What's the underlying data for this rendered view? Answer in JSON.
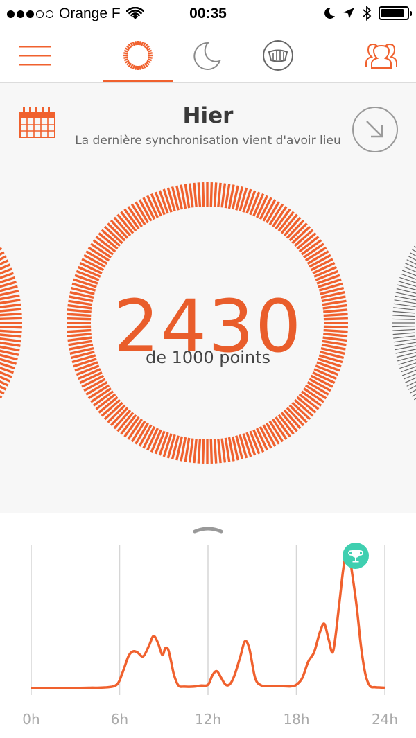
{
  "status_bar": {
    "carrier": "Orange F",
    "time": "00:35",
    "signal_strength": 3,
    "signal_max": 5,
    "battery_level": 0.9,
    "icons": [
      "wifi-icon",
      "moon-icon",
      "location-arrow-icon",
      "bluetooth-icon",
      "battery-icon"
    ]
  },
  "nav": {
    "items": [
      "menu-icon",
      "activity-ring-icon",
      "sleep-moon-icon",
      "meal-plate-icon",
      "friends-icon"
    ],
    "active": "activity-ring-icon"
  },
  "header": {
    "title": "Hier",
    "subtitle": "La dernière synchronisation vient d'avoir lieu"
  },
  "score": {
    "value": "2430",
    "goal_text": "de 1000 points"
  },
  "colors": {
    "accent": "#f0612e",
    "trophy": "#3fcfb0",
    "ring_neighbor": "#666666"
  },
  "chart_data": {
    "type": "line",
    "x_tick_labels": [
      "0h",
      "6h",
      "12h",
      "18h",
      "24h"
    ],
    "xlim": [
      0,
      24
    ],
    "grid": true,
    "series": [
      {
        "x": [
          0,
          1,
          2,
          3,
          4,
          5,
          5.8,
          6.2,
          6.6,
          6.9,
          7.2,
          7.6,
          8,
          8.3,
          8.6,
          8.9,
          9.1,
          9.3,
          9.5,
          9.7,
          10,
          10.4,
          11,
          11.5,
          12,
          12.3,
          12.6,
          12.9,
          13.2,
          13.5,
          13.8,
          14.2,
          14.5,
          14.8,
          15.2,
          15.6,
          16,
          17,
          17.6,
          18,
          18.4,
          18.8,
          19.2,
          19.6,
          19.9,
          20.2,
          20.5,
          20.9,
          21.2,
          21.5,
          21.8,
          22.1,
          22.4,
          22.7,
          23,
          23.3,
          23.6,
          24
        ],
        "y": [
          0.2,
          0.2,
          0.3,
          0.3,
          0.4,
          0.5,
          1.5,
          6,
          12,
          13.8,
          13.5,
          12,
          16,
          19.5,
          17,
          12.5,
          15,
          14.5,
          10,
          5,
          1.2,
          0.8,
          0.8,
          1.2,
          1.5,
          5,
          6.5,
          4,
          1.5,
          1.8,
          5,
          12,
          17.5,
          15,
          4,
          1.3,
          1.1,
          1,
          0.9,
          1.5,
          4,
          10,
          13.5,
          21,
          24,
          18,
          14,
          31,
          45,
          52,
          42,
          30,
          15,
          5,
          1,
          0.6,
          0.5,
          0.4
        ]
      }
    ]
  }
}
